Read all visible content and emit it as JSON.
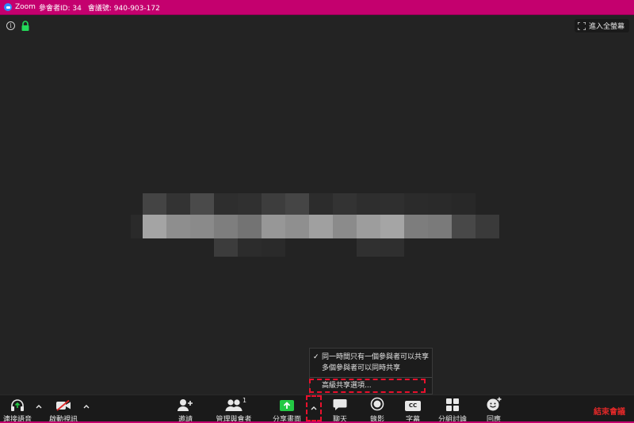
{
  "titlebar": {
    "app": "Zoom",
    "participant_id": "參會者ID: 34",
    "meeting_id": "會議號: 940-903-172",
    "bg_color": "#c4006e"
  },
  "header": {
    "fullscreen_label": "進入全螢幕",
    "info_icon": "info-icon",
    "lock_icon": "lock-icon",
    "lock_color": "#23d959"
  },
  "share_menu": {
    "options": [
      {
        "label": "同一時間只有一個參與者可以共享",
        "checked": true
      },
      {
        "label": "多個參與者可以同時共享",
        "checked": false
      }
    ],
    "advanced_label": "高級共享選項..."
  },
  "toolbar": {
    "audio_label": "連接語音",
    "video_label": "啟動視訊",
    "invite_label": "邀請",
    "participants_label": "管理與會者",
    "participants_count": "1",
    "share_label": "分享畫面",
    "chat_label": "聊天",
    "record_label": "錄影",
    "cc_label": "字幕",
    "cc_icon_text": "CC",
    "breakout_label": "分組討論",
    "reactions_label": "回應",
    "end_label": "結束會議",
    "share_color": "#23c944",
    "end_color": "#e02828"
  },
  "annotation": {
    "callout_color": "#e8112d"
  }
}
